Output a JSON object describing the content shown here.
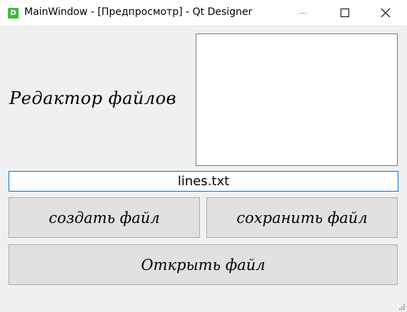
{
  "window": {
    "icon_letter": "D",
    "title": "MainWindow - [Предпросмотр] - Qt Designer"
  },
  "main": {
    "heading": "Редактор файлов",
    "filename_value": "lines.txt",
    "create_label": "создать файл",
    "save_label": "сохранить файл",
    "open_label": "Открыть файл"
  },
  "icons": {
    "app": "qt-designer-icon",
    "minimize": "minimize-icon",
    "maximize": "maximize-icon",
    "close": "close-icon",
    "grip": "size-grip-icon"
  },
  "colors": {
    "app_icon": "#41b93f",
    "input_focus_border": "#0078d7",
    "button_face": "#e1e1e1",
    "window_bg": "#f0f0f0"
  }
}
